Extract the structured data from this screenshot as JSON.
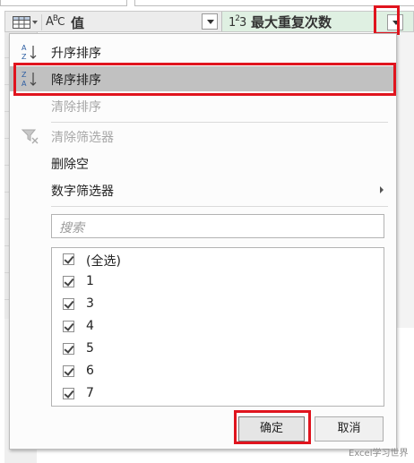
{
  "header": {
    "table_icon": "table-grid-icon",
    "text_type_icon": "abc-type-icon",
    "text_type_glyph": "A",
    "text_type_glyph2": "B",
    "text_type_glyph3": "C",
    "column1_name": "值",
    "number_type_icon": "123-type-icon",
    "number_type_glyph": "1",
    "number_type_sup": "2",
    "number_type_glyph2": "3",
    "column2_name": "最大重复次数",
    "column2_header_color": "#dff0e2"
  },
  "menu": {
    "items": [
      {
        "label": "升序排序",
        "icon": "sort-ascending-icon",
        "enabled": true
      },
      {
        "label": "降序排序",
        "icon": "sort-descending-icon",
        "enabled": true,
        "selected": true
      },
      {
        "label": "清除排序",
        "enabled": false
      },
      {
        "label": "清除筛选器",
        "icon": "clear-filter-icon",
        "enabled": false
      },
      {
        "label": "删除空",
        "enabled": true
      },
      {
        "label": "数字筛选器",
        "enabled": true,
        "submenu": true
      }
    ]
  },
  "search": {
    "placeholder": "搜索"
  },
  "values": [
    {
      "label": "(全选)",
      "checked": true
    },
    {
      "label": "1",
      "checked": true
    },
    {
      "label": "3",
      "checked": true
    },
    {
      "label": "4",
      "checked": true
    },
    {
      "label": "5",
      "checked": true
    },
    {
      "label": "6",
      "checked": true
    },
    {
      "label": "7",
      "checked": true
    }
  ],
  "buttons": {
    "ok": "确定",
    "cancel": "取消"
  },
  "highlight_color": "#e0141e",
  "watermark": "Excel学习世界"
}
